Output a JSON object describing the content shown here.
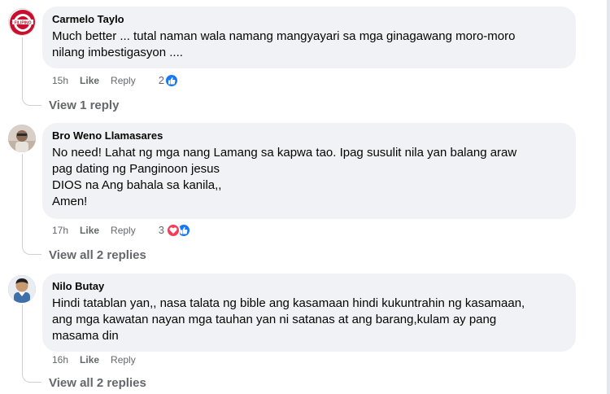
{
  "comments": [
    {
      "author": "Carmelo Taylo",
      "avatar_color": "#c8102e",
      "avatar_label": "FILIPINO",
      "lines": [
        "Much better ... tutal naman wala namang mangyayari sa mga ginagawang moro-moro",
        "nilang imbestigasyon ...."
      ],
      "time": "15h",
      "like_label": "Like",
      "reply_label": "Reply",
      "reaction_count": "2",
      "reactions": [
        "like-icon"
      ],
      "view_replies": "View 1 reply"
    },
    {
      "author": "Bro Weno Llamasares",
      "avatar_color": "#b9a99a",
      "lines": [
        "No need! Lahat ng mga nang Lamang sa kapwa tao. Ipag susulit nila yan balang araw",
        "pag dating ng Panginoon jesus",
        "DIOS na Ang bahala sa kanila,,",
        "Amen!"
      ],
      "time": "17h",
      "like_label": "Like",
      "reply_label": "Reply",
      "reaction_count": "3",
      "reactions": [
        "love-icon",
        "like-icon"
      ],
      "view_replies": "View all 2 replies"
    },
    {
      "author": "Nilo Butay",
      "avatar_color": "#5b86b5",
      "lines": [
        "Hindi tatablan yan,, nasa talata ng bible ang kasamaan hindi kukuntrahin ng kasamaan,",
        "ang mga kawatan nayan mga tauhan yan ni satanas at ang barang,kulam ay pang",
        "masama din"
      ],
      "time": "16h",
      "like_label": "Like",
      "reply_label": "Reply",
      "view_replies": "View all 2 replies"
    }
  ],
  "colors": {
    "bubble": "#f0f2f5",
    "meta": "#65676b",
    "like_blue": "#1877f2",
    "love_red": "#f33e58"
  }
}
